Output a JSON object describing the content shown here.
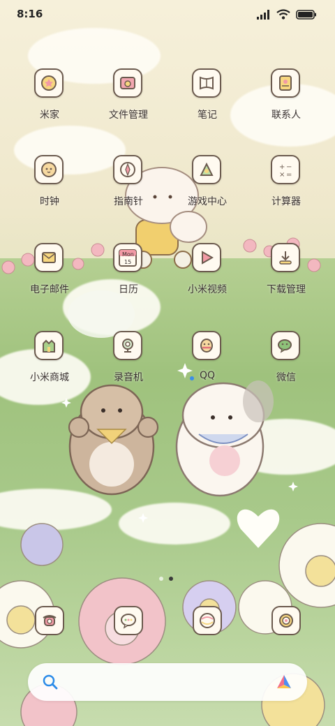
{
  "status_bar": {
    "time": "8:16",
    "icons": [
      "signal-icon",
      "wifi-icon",
      "battery-icon"
    ]
  },
  "home_grid": [
    {
      "label": "米家",
      "icon": "mijia-icon"
    },
    {
      "label": "文件管理",
      "icon": "file-manager-icon"
    },
    {
      "label": "笔记",
      "icon": "notes-icon"
    },
    {
      "label": "联系人",
      "icon": "contacts-icon"
    },
    {
      "label": "时钟",
      "icon": "clock-icon"
    },
    {
      "label": "指南针",
      "icon": "compass-icon"
    },
    {
      "label": "游戏中心",
      "icon": "game-center-icon"
    },
    {
      "label": "计算器",
      "icon": "calculator-icon"
    },
    {
      "label": "电子邮件",
      "icon": "email-icon"
    },
    {
      "label": "日历",
      "icon": "calendar-icon",
      "icon_text": [
        "Mon",
        "15"
      ]
    },
    {
      "label": "小米视频",
      "icon": "video-icon"
    },
    {
      "label": "下载管理",
      "icon": "download-icon"
    },
    {
      "label": "小米商城",
      "icon": "mi-store-icon"
    },
    {
      "label": "录音机",
      "icon": "recorder-icon"
    },
    {
      "label": "QQ",
      "icon": "qq-icon",
      "has_notification_dot": true
    },
    {
      "label": "微信",
      "icon": "wechat-icon"
    }
  ],
  "page_indicator": {
    "pages": 2,
    "current": 1
  },
  "dock": [
    {
      "icon": "phone-icon"
    },
    {
      "icon": "messages-icon"
    },
    {
      "icon": "browser-icon"
    },
    {
      "icon": "camera-icon"
    }
  ],
  "search_bar": {
    "search_icon": "search-icon",
    "assistant_icon": "assistant-icon"
  },
  "colors": {
    "icon_outline": "#6b5a4e",
    "icon_fill": "#fffaf0",
    "label": "#3a3230",
    "qq_dot": "#3b8ee8"
  }
}
